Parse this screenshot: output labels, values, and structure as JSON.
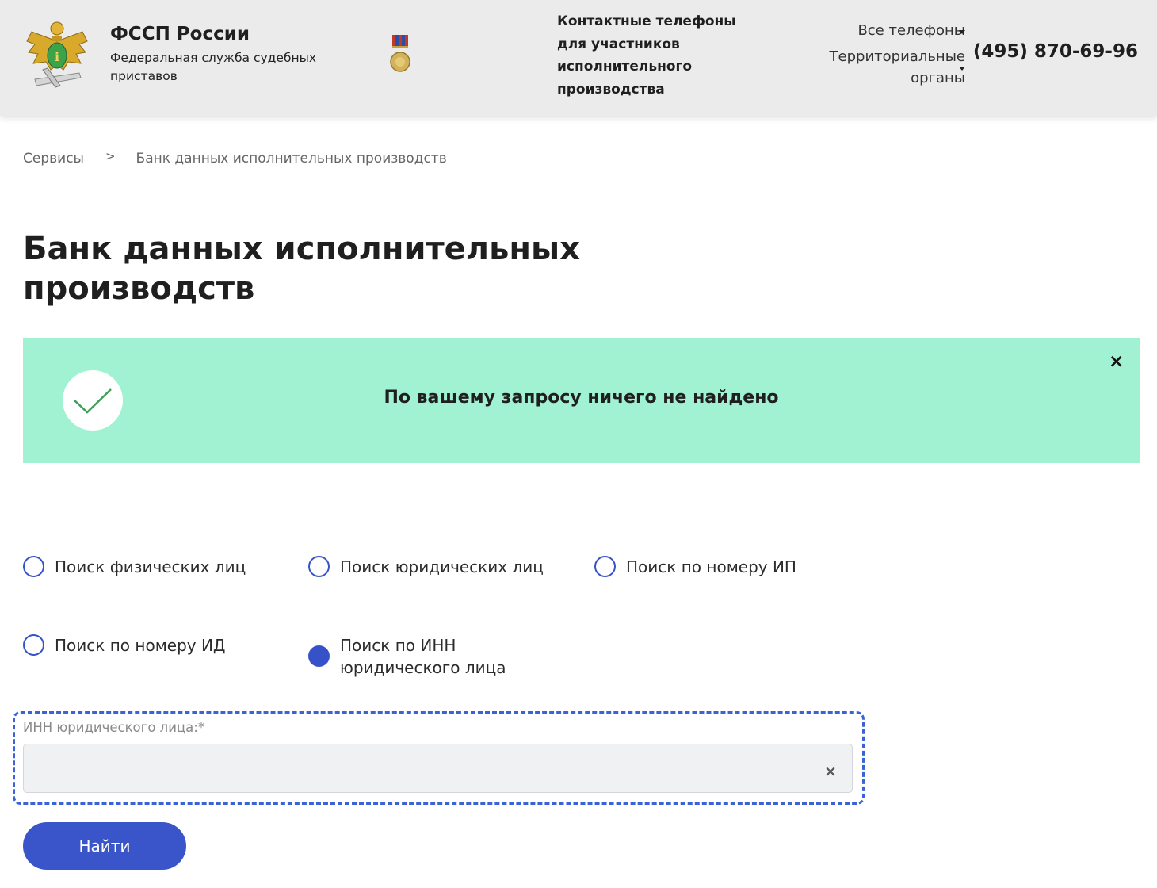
{
  "header": {
    "org_name": "ФССП России",
    "org_subtitle": "Федеральная служба судебных приставов",
    "logo_icon": "eagle-emblem-icon",
    "medal_icon": "medal-icon",
    "contacts_title": "Контактные телефоны для участников исполнительного производства",
    "all_phones": "Все телефоны",
    "territorial": "Территориальные органы",
    "phone": "(495) 870-69-96"
  },
  "breadcrumb": {
    "items": [
      "Сервисы",
      "Банк данных исполнительных производств"
    ],
    "separator": ">"
  },
  "page_title": "Банк данных исполнительных производств",
  "alert": {
    "message": "По вашему запросу ничего не найдено",
    "close": "×",
    "color": "#a0f2d3",
    "icon": "checkmark-icon"
  },
  "search_types": [
    {
      "label": "Поиск физических лиц",
      "checked": false
    },
    {
      "label": "Поиск юридических лиц",
      "checked": false
    },
    {
      "label": "Поиск по номеру ИП",
      "checked": false
    },
    {
      "label": "Поиск по номеру ИД",
      "checked": false
    },
    {
      "label": "Поиск по ИНН юридического лица",
      "checked": true
    }
  ],
  "form": {
    "inn_label": "ИНН юридического лица:*",
    "inn_value": "",
    "clear": "×",
    "submit": "Найти"
  },
  "colors": {
    "accent": "#3a55c9",
    "header_bg": "#ebebeb",
    "highlight_border": "#3a63d6"
  }
}
